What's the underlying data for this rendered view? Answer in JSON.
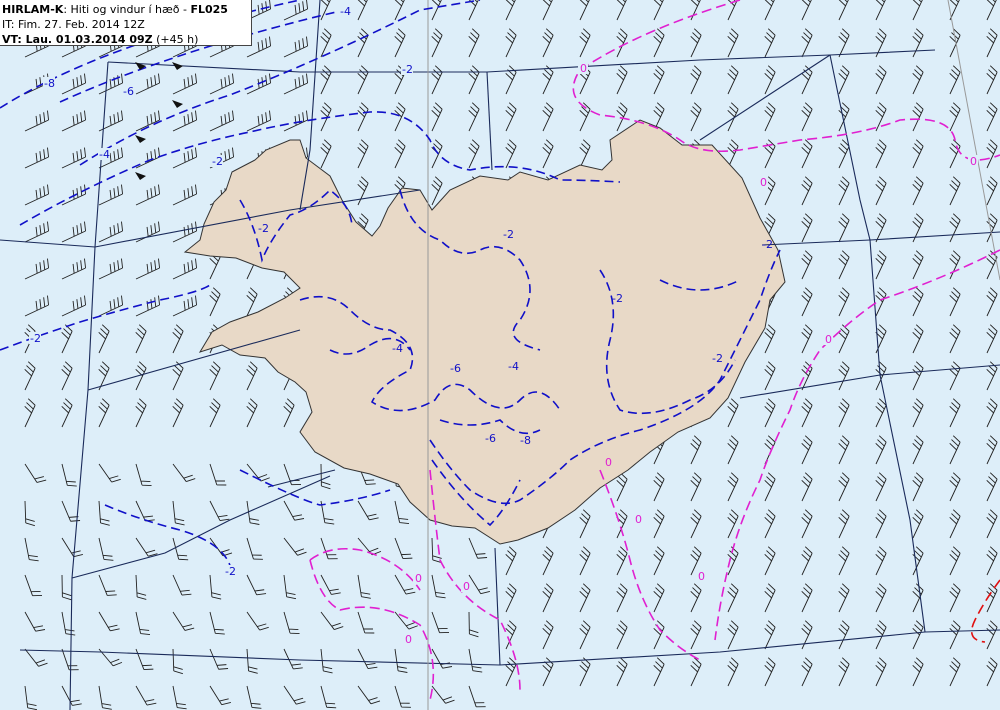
{
  "header": {
    "model": "HIRLAM-K",
    "sep1": ": ",
    "product": "Hiti og vindur í hæð",
    "sep2": " - ",
    "level": "FL025",
    "it_line": "IT: Fim. 27. Feb. 2014 12Z",
    "vt_label": "VT: Lau. 01.03.2014 09Z",
    "vt_offset": " (+45 h)"
  },
  "colors": {
    "sea": "#ddeef9",
    "land": "#e8d9c7",
    "coast": "#333333",
    "graticule": "#1a2a5a",
    "meridian": "#999999",
    "negative_isotherm": "#1010c8",
    "zero_isotherm": "#e020d0",
    "positive_isotherm": "#e01010",
    "wind_barb": "#222222"
  },
  "isotherm_labels": {
    "m8": "-8",
    "m6": "-6",
    "m4": "-4",
    "m2": "-2",
    "zero": "0"
  }
}
